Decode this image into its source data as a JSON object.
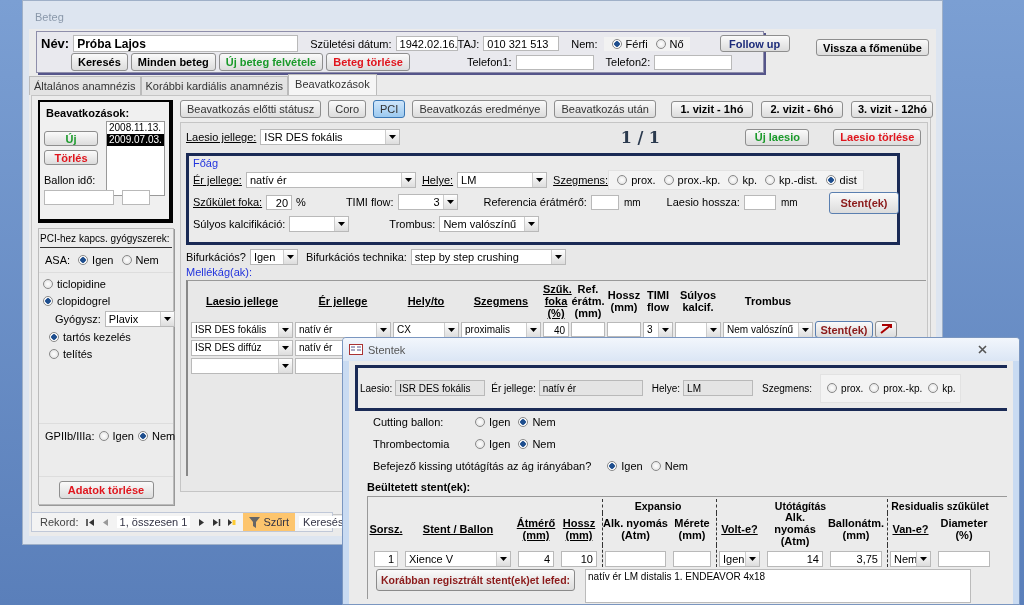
{
  "main_window": {
    "title": "Beteg"
  },
  "patient": {
    "name_label": "Név:",
    "name": "Próba Lajos",
    "birth_label": "Születési dátum:",
    "birth": "1942.02.16.",
    "taj_label": "TAJ:",
    "taj": "010 321 513",
    "sex_label": "Nem:",
    "sex_options": [
      {
        "label": "Férfi",
        "selected": true
      },
      {
        "label": "Nő",
        "selected": false
      }
    ],
    "phone1_label": "Telefon1:",
    "phone2_label": "Telefon2:",
    "buttons": [
      {
        "label": "Keresés",
        "kind": "plain"
      },
      {
        "label": "Minden beteg",
        "kind": "plain"
      },
      {
        "label": "Új beteg felvétele",
        "kind": "green"
      },
      {
        "label": "Beteg törlése",
        "kind": "red"
      }
    ],
    "follow_up": "Follow up"
  },
  "back_button": "Vissza a főmenübe",
  "tabs": [
    {
      "label": "Általános anamnézis",
      "selected": false
    },
    {
      "label": "Korábbi kardiális anamnézis",
      "selected": false
    },
    {
      "label": "Beavatkozások",
      "selected": true
    }
  ],
  "procedures": {
    "title": "Beavatkozások:",
    "new": "Új",
    "delete": "Törlés",
    "dates": [
      {
        "label": "2008.11.13.",
        "selected": false
      },
      {
        "label": "2009.07.03.",
        "selected": true
      }
    ],
    "balloon_label": "Ballon idő:"
  },
  "medications": {
    "title": "PCI-hez kapcs. gyógyszerek:",
    "asa_label": "ASA:",
    "asa": [
      {
        "label": "Igen",
        "selected": true
      },
      {
        "label": "Nem",
        "selected": false
      }
    ],
    "drugs": [
      {
        "label": "ticlopidine",
        "selected": false
      },
      {
        "label": "clopidogrel",
        "selected": true
      }
    ],
    "drug_label": "Gyógysz:",
    "drug": "Plavix",
    "modes": [
      {
        "label": "tartós kezelés",
        "selected": true
      },
      {
        "label": "telítés",
        "selected": false
      }
    ],
    "gp_label": "GPIIb/IIIa:",
    "gp": [
      {
        "label": "Igen",
        "selected": false
      },
      {
        "label": "Nem",
        "selected": true
      }
    ],
    "delete": "Adatok törlése"
  },
  "record_bar": {
    "label": "Rekord:",
    "position": "1, összesen 1",
    "filter": "Szűrt",
    "search": "Keresés"
  },
  "subtabs": [
    {
      "label": "Beavatkozás előtti státusz",
      "selected": false
    },
    {
      "label": "Coro",
      "selected": false
    },
    {
      "label": "PCI",
      "selected": true
    },
    {
      "label": "Beavatkozás eredménye",
      "selected": false
    },
    {
      "label": "Beavatkozás után",
      "selected": false
    }
  ],
  "visits": [
    "1. vizit - 1hó",
    "2. vizit - 6hó",
    "3. vizit - 12hó"
  ],
  "lesion": {
    "type_label": "Laesio jellege:",
    "type": "ISR DES fokális",
    "counter": "1 / 1",
    "new": "Új laesio",
    "delete": "Laesio törlése"
  },
  "main_branch": {
    "title": "Főág",
    "vessel_label": "Ér jellege:",
    "vessel": "natív ér",
    "site_label": "Helye:",
    "site": "LM",
    "segment_label": "Szegmens:",
    "segments": [
      {
        "label": "prox.",
        "selected": false
      },
      {
        "label": "prox.-kp.",
        "selected": false
      },
      {
        "label": "kp.",
        "selected": false
      },
      {
        "label": "kp.-dist.",
        "selected": false
      },
      {
        "label": "dist",
        "selected": true
      }
    ],
    "stenosis_label": "Szűkület foka:",
    "stenosis": "20",
    "stenosis_unit": "%",
    "timi_label": "TIMI flow:",
    "timi": "3",
    "ref_label": "Referencia érátmérő:",
    "ref_unit": "mm",
    "length_label": "Laesio hossza:",
    "length_unit": "mm",
    "calc_label": "Súlyos kalcifikáció:",
    "thrombus_label": "Trombus:",
    "thrombus": "Nem valószínű",
    "stent_button": "Stent(ek)"
  },
  "bifurcation": {
    "label": "Bifurkációs?",
    "value": "Igen",
    "technique_label": "Bifurkációs technika:",
    "technique": "step by step crushing"
  },
  "side_branches": {
    "title": "Mellékág(ak):",
    "columns": [
      {
        "label": "Laesio jellege",
        "underlined": true
      },
      {
        "label": "Ér jellege",
        "underlined": true
      },
      {
        "label": "Hely/to",
        "underlined": true
      },
      {
        "label": "Szegmens",
        "underlined": true
      },
      {
        "label": "Szűk. foka (%)",
        "underlined": true
      },
      {
        "label": "Ref. érátm. (mm)",
        "underlined": false
      },
      {
        "label": "Hossz (mm)",
        "underlined": false
      },
      {
        "label": "TIMI flow",
        "underlined": false
      },
      {
        "label": "Súlyos kalcif.",
        "underlined": false
      },
      {
        "label": "Trombus",
        "underlined": false
      }
    ],
    "rows": [
      {
        "cells": [
          {
            "kind": "select",
            "value": "ISR DES fokális"
          },
          {
            "kind": "select",
            "value": "natív ér"
          },
          {
            "kind": "select",
            "value": "CX"
          },
          {
            "kind": "select",
            "value": "proximalis"
          },
          {
            "kind": "input",
            "value": "40"
          },
          {
            "kind": "input"
          },
          {
            "kind": "input"
          },
          {
            "kind": "select",
            "value": "3"
          },
          {
            "kind": "select"
          },
          {
            "kind": "select",
            "value": "Nem valószínű"
          },
          {
            "kind": "button",
            "value": "Stent(ek)"
          },
          {
            "kind": "delete"
          }
        ]
      },
      {
        "cells": [
          {
            "kind": "select",
            "value": "ISR DES diffúz"
          },
          {
            "kind": "select",
            "value": "natív ér"
          }
        ]
      },
      {
        "cells": [
          {
            "kind": "select"
          },
          {
            "kind": "select"
          }
        ]
      }
    ]
  },
  "stent_dialog": {
    "title": "Stentek",
    "lesion_label": "Laesio:",
    "lesion": "ISR DES fokális",
    "vessel_label": "Ér jellege:",
    "vessel": "natív ér",
    "site_label": "Helye:",
    "site": "LM",
    "segment_label": "Szegmens:",
    "segments": [
      {
        "label": "prox.",
        "selected": false
      },
      {
        "label": "prox.-kp.",
        "selected": false
      },
      {
        "label": "kp.",
        "selected": false
      }
    ],
    "questions": [
      {
        "label": "Cutting ballon:",
        "options": [
          {
            "label": "Igen",
            "selected": false
          },
          {
            "label": "Nem",
            "selected": true
          }
        ]
      },
      {
        "label": "Thrombectomia",
        "options": [
          {
            "label": "Igen",
            "selected": false
          },
          {
            "label": "Nem",
            "selected": true
          }
        ]
      },
      {
        "label": "Befejező kissing utótágítás az ág irányában?",
        "options": [
          {
            "label": "Igen",
            "selected": true
          },
          {
            "label": "Nem",
            "selected": false
          }
        ]
      }
    ],
    "stents_title": "Beültetett stent(ek):",
    "columns": [
      {
        "label": "Sorsz.",
        "underlined": true
      },
      {
        "label": "Stent / Ballon",
        "underlined": true
      },
      {
        "label": "Átmérő (mm)",
        "underlined": true
      },
      {
        "label": "Hossz (mm)",
        "underlined": true
      },
      {
        "group": "Expansio",
        "columns": [
          {
            "label": "Alk. nyomás (Atm)",
            "underlined": false
          },
          {
            "label": "Mérete (mm)",
            "underlined": false
          }
        ]
      },
      {
        "group": "Utótágítás",
        "columns": [
          {
            "label": "Volt-e?",
            "underlined": true
          },
          {
            "label": "Alk. nyomás (Atm)",
            "underlined": false
          },
          {
            "label": "Ballonátm. (mm)",
            "underlined": false
          }
        ]
      },
      {
        "group": "Residualis szűkület",
        "columns": [
          {
            "label": "Van-e?",
            "underlined": true
          },
          {
            "label": "Diameter (%)",
            "underlined": false
          }
        ]
      }
    ],
    "row": [
      {
        "kind": "input",
        "value": "1"
      },
      {
        "kind": "select",
        "value": "Xience V"
      },
      {
        "kind": "input",
        "value": "4"
      },
      {
        "kind": "input",
        "value": "10"
      },
      {
        "kind": "input"
      },
      {
        "kind": "input"
      },
      {
        "kind": "select",
        "value": "Igen"
      },
      {
        "kind": "input",
        "value": "14"
      },
      {
        "kind": "input",
        "value": "3,75"
      },
      {
        "kind": "select",
        "value": "Nem"
      },
      {
        "kind": "input"
      }
    ],
    "cover_button": "Korábban regisztrált stent(ek)et lefed:",
    "note": "natív ér LM distalis 1. ENDEAVOR 4x18"
  }
}
